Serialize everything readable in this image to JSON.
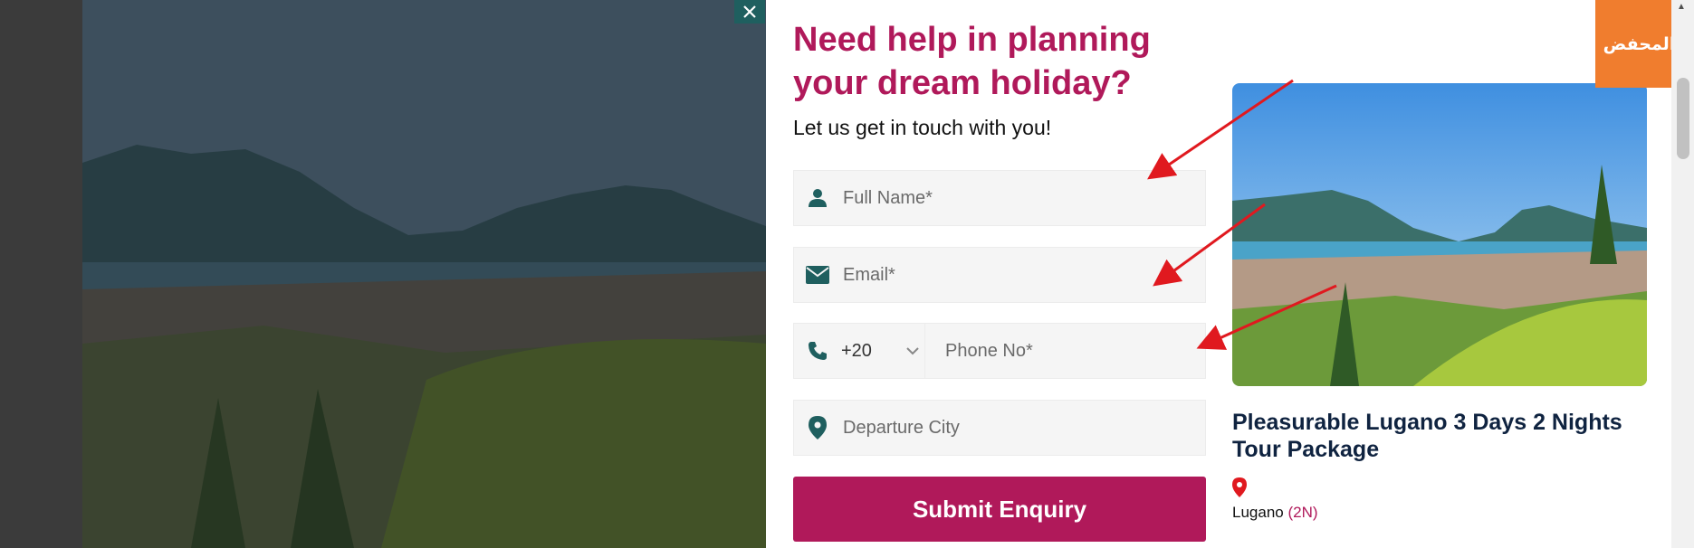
{
  "modal": {
    "close_icon": "close-icon",
    "title": "Need help in planning your dream holiday?",
    "subtitle": "Let us get in touch with you!"
  },
  "form": {
    "full_name": {
      "placeholder": "Full Name*",
      "value": "",
      "icon": "user-icon"
    },
    "email": {
      "placeholder": "Email*",
      "value": "",
      "icon": "envelope-icon"
    },
    "phone": {
      "country_code": "+20",
      "placeholder": "Phone No*",
      "value": "",
      "icon": "phone-icon"
    },
    "departure_city": {
      "placeholder": "Departure City",
      "value": "",
      "icon": "map-pin-icon"
    },
    "submit_label": "Submit Enquiry"
  },
  "package": {
    "title": "Pleasurable Lugano 3 Days 2 Nights Tour Package",
    "location": "Lugano",
    "nights": "(2N)"
  },
  "logo": {
    "text": "المحفض"
  },
  "colors": {
    "brand": "#b0195a",
    "accent_teal": "#1f5f5f",
    "logo_bg": "#f07d2e",
    "annotation_arrow": "#e0191f"
  }
}
